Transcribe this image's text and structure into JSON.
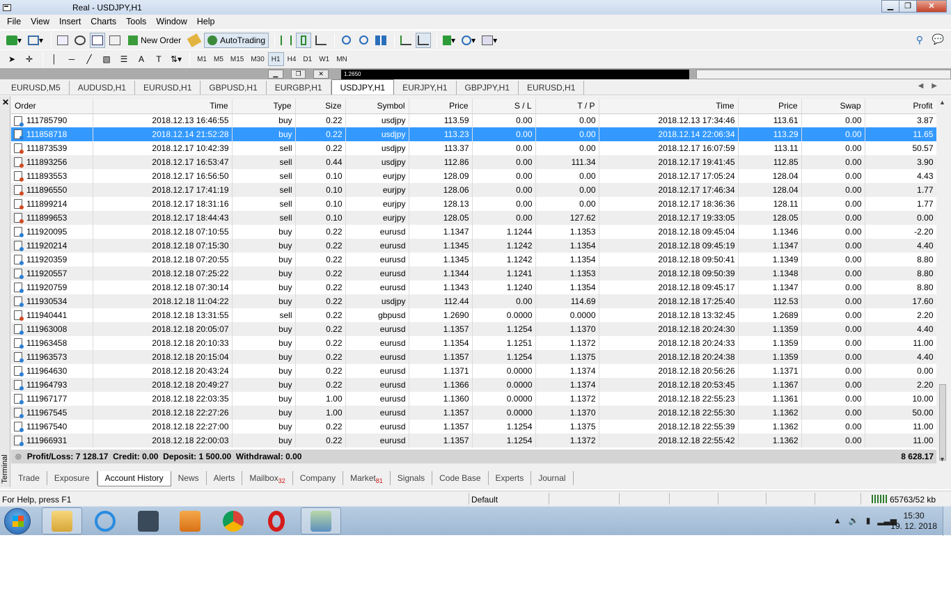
{
  "window": {
    "title": "Real - USDJPY,H1",
    "minimize": "▁",
    "maximize": "❐",
    "close": "✕"
  },
  "menu": [
    "File",
    "View",
    "Insert",
    "Charts",
    "Tools",
    "Window",
    "Help"
  ],
  "toolbar": {
    "new_order": "New Order",
    "autotrading": "AutoTrading"
  },
  "timeframes": [
    "M1",
    "M5",
    "M15",
    "M30",
    "H1",
    "H4",
    "D1",
    "W1",
    "MN"
  ],
  "active_timeframe": "H1",
  "mdi": {
    "chart_label": "1.2650"
  },
  "chart_tabs": [
    "EURUSD,M5",
    "AUDUSD,H1",
    "EURUSD,H1",
    "GBPUSD,H1",
    "EURGBP,H1",
    "USDJPY,H1",
    "EURJPY,H1",
    "GBPJPY,H1",
    "EURUSD,H1"
  ],
  "active_chart_tab": "USDJPY,H1",
  "terminal": {
    "side_label": "Terminal",
    "columns": [
      "Order",
      "Time",
      "Type",
      "Size",
      "Symbol",
      "Price",
      "S / L",
      "T / P",
      "Time",
      "Price",
      "Swap",
      "Profit"
    ],
    "rows": [
      [
        "111785790",
        "2018.12.13 16:46:55",
        "buy",
        "0.22",
        "usdjpy",
        "113.59",
        "0.00",
        "0.00",
        "2018.12.13 17:34:46",
        "113.61",
        "0.00",
        "3.87"
      ],
      [
        "111858718",
        "2018.12.14 21:52:28",
        "buy",
        "0.22",
        "usdjpy",
        "113.23",
        "0.00",
        "0.00",
        "2018.12.14 22:06:34",
        "113.29",
        "0.00",
        "11.65"
      ],
      [
        "111873539",
        "2018.12.17 10:42:39",
        "sell",
        "0.22",
        "usdjpy",
        "113.37",
        "0.00",
        "0.00",
        "2018.12.17 16:07:59",
        "113.11",
        "0.00",
        "50.57"
      ],
      [
        "111893256",
        "2018.12.17 16:53:47",
        "sell",
        "0.44",
        "usdjpy",
        "112.86",
        "0.00",
        "111.34",
        "2018.12.17 19:41:45",
        "112.85",
        "0.00",
        "3.90"
      ],
      [
        "111893553",
        "2018.12.17 16:56:50",
        "sell",
        "0.10",
        "eurjpy",
        "128.09",
        "0.00",
        "0.00",
        "2018.12.17 17:05:24",
        "128.04",
        "0.00",
        "4.43"
      ],
      [
        "111896550",
        "2018.12.17 17:41:19",
        "sell",
        "0.10",
        "eurjpy",
        "128.06",
        "0.00",
        "0.00",
        "2018.12.17 17:46:34",
        "128.04",
        "0.00",
        "1.77"
      ],
      [
        "111899214",
        "2018.12.17 18:31:16",
        "sell",
        "0.10",
        "eurjpy",
        "128.13",
        "0.00",
        "0.00",
        "2018.12.17 18:36:36",
        "128.11",
        "0.00",
        "1.77"
      ],
      [
        "111899653",
        "2018.12.17 18:44:43",
        "sell",
        "0.10",
        "eurjpy",
        "128.05",
        "0.00",
        "127.62",
        "2018.12.17 19:33:05",
        "128.05",
        "0.00",
        "0.00"
      ],
      [
        "111920095",
        "2018.12.18 07:10:55",
        "buy",
        "0.22",
        "eurusd",
        "1.1347",
        "1.1244",
        "1.1353",
        "2018.12.18 09:45:04",
        "1.1346",
        "0.00",
        "-2.20"
      ],
      [
        "111920214",
        "2018.12.18 07:15:30",
        "buy",
        "0.22",
        "eurusd",
        "1.1345",
        "1.1242",
        "1.1354",
        "2018.12.18 09:45:19",
        "1.1347",
        "0.00",
        "4.40"
      ],
      [
        "111920359",
        "2018.12.18 07:20:55",
        "buy",
        "0.22",
        "eurusd",
        "1.1345",
        "1.1242",
        "1.1354",
        "2018.12.18 09:50:41",
        "1.1349",
        "0.00",
        "8.80"
      ],
      [
        "111920557",
        "2018.12.18 07:25:22",
        "buy",
        "0.22",
        "eurusd",
        "1.1344",
        "1.1241",
        "1.1353",
        "2018.12.18 09:50:39",
        "1.1348",
        "0.00",
        "8.80"
      ],
      [
        "111920759",
        "2018.12.18 07:30:14",
        "buy",
        "0.22",
        "eurusd",
        "1.1343",
        "1.1240",
        "1.1354",
        "2018.12.18 09:45:17",
        "1.1347",
        "0.00",
        "8.80"
      ],
      [
        "111930534",
        "2018.12.18 11:04:22",
        "buy",
        "0.22",
        "usdjpy",
        "112.44",
        "0.00",
        "114.69",
        "2018.12.18 17:25:40",
        "112.53",
        "0.00",
        "17.60"
      ],
      [
        "111940441",
        "2018.12.18 13:31:55",
        "sell",
        "0.22",
        "gbpusd",
        "1.2690",
        "0.0000",
        "0.0000",
        "2018.12.18 13:32:45",
        "1.2689",
        "0.00",
        "2.20"
      ],
      [
        "111963008",
        "2018.12.18 20:05:07",
        "buy",
        "0.22",
        "eurusd",
        "1.1357",
        "1.1254",
        "1.1370",
        "2018.12.18 20:24:30",
        "1.1359",
        "0.00",
        "4.40"
      ],
      [
        "111963458",
        "2018.12.18 20:10:33",
        "buy",
        "0.22",
        "eurusd",
        "1.1354",
        "1.1251",
        "1.1372",
        "2018.12.18 20:24:33",
        "1.1359",
        "0.00",
        "11.00"
      ],
      [
        "111963573",
        "2018.12.18 20:15:04",
        "buy",
        "0.22",
        "eurusd",
        "1.1357",
        "1.1254",
        "1.1375",
        "2018.12.18 20:24:38",
        "1.1359",
        "0.00",
        "4.40"
      ],
      [
        "111964630",
        "2018.12.18 20:43:24",
        "buy",
        "0.22",
        "eurusd",
        "1.1371",
        "0.0000",
        "1.1374",
        "2018.12.18 20:56:26",
        "1.1371",
        "0.00",
        "0.00"
      ],
      [
        "111964793",
        "2018.12.18 20:49:27",
        "buy",
        "0.22",
        "eurusd",
        "1.1366",
        "0.0000",
        "1.1374",
        "2018.12.18 20:53:45",
        "1.1367",
        "0.00",
        "2.20"
      ],
      [
        "111967177",
        "2018.12.18 22:03:35",
        "buy",
        "1.00",
        "eurusd",
        "1.1360",
        "0.0000",
        "1.1372",
        "2018.12.18 22:55:23",
        "1.1361",
        "0.00",
        "10.00"
      ],
      [
        "111967545",
        "2018.12.18 22:27:26",
        "buy",
        "1.00",
        "eurusd",
        "1.1357",
        "0.0000",
        "1.1370",
        "2018.12.18 22:55:30",
        "1.1362",
        "0.00",
        "50.00"
      ],
      [
        "111967540",
        "2018.12.18 22:27:00",
        "buy",
        "0.22",
        "eurusd",
        "1.1357",
        "1.1254",
        "1.1375",
        "2018.12.18 22:55:39",
        "1.1362",
        "0.00",
        "11.00"
      ],
      [
        "111966931",
        "2018.12.18 22:00:03",
        "buy",
        "0.22",
        "eurusd",
        "1.1357",
        "1.1254",
        "1.1372",
        "2018.12.18 22:55:42",
        "1.1362",
        "0.00",
        "11.00"
      ]
    ],
    "selected_order": "111858718",
    "summary": "Profit/Loss: 7 128.17  Credit: 0.00  Deposit: 1 500.00  Withdrawal: 0.00",
    "summary_total": "8 628.17",
    "tabs": [
      {
        "label": "Trade"
      },
      {
        "label": "Exposure"
      },
      {
        "label": "Account History",
        "active": true
      },
      {
        "label": "News"
      },
      {
        "label": "Alerts"
      },
      {
        "label": "Mailbox",
        "badge": "32"
      },
      {
        "label": "Company"
      },
      {
        "label": "Market",
        "badge": "81"
      },
      {
        "label": "Signals"
      },
      {
        "label": "Code Base"
      },
      {
        "label": "Experts"
      },
      {
        "label": "Journal"
      }
    ]
  },
  "status": {
    "help": "For Help, press F1",
    "profile": "Default",
    "memory": "65763/52 kb"
  },
  "taskbar": {
    "time": "15:30",
    "date": "19. 12. 2018"
  }
}
